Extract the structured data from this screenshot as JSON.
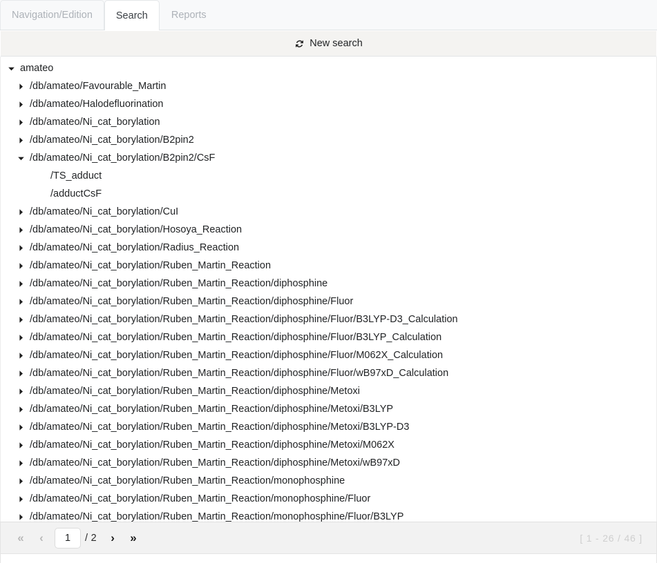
{
  "tabs": [
    {
      "label": "Navigation/Edition",
      "active": false
    },
    {
      "label": "Search",
      "active": true
    },
    {
      "label": "Reports",
      "active": false
    }
  ],
  "toolbar": {
    "new_search_label": "New search",
    "refresh_icon": "refresh-icon"
  },
  "tree": {
    "nodes": [
      {
        "label": "amateo",
        "level": 0,
        "state": "expanded"
      },
      {
        "label": "/db/amateo/Favourable_Martin",
        "level": 1,
        "state": "collapsed"
      },
      {
        "label": "/db/amateo/Halodefluorination",
        "level": 1,
        "state": "collapsed"
      },
      {
        "label": "/db/amateo/Ni_cat_borylation",
        "level": 1,
        "state": "collapsed"
      },
      {
        "label": "/db/amateo/Ni_cat_borylation/B2pin2",
        "level": 1,
        "state": "collapsed"
      },
      {
        "label": "/db/amateo/Ni_cat_borylation/B2pin2/CsF",
        "level": 1,
        "state": "expanded"
      },
      {
        "label": "/TS_adduct",
        "level": 2,
        "state": "leaf"
      },
      {
        "label": "/adductCsF",
        "level": 2,
        "state": "leaf"
      },
      {
        "label": "/db/amateo/Ni_cat_borylation/CuI",
        "level": 1,
        "state": "collapsed"
      },
      {
        "label": "/db/amateo/Ni_cat_borylation/Hosoya_Reaction",
        "level": 1,
        "state": "collapsed"
      },
      {
        "label": "/db/amateo/Ni_cat_borylation/Radius_Reaction",
        "level": 1,
        "state": "collapsed"
      },
      {
        "label": "/db/amateo/Ni_cat_borylation/Ruben_Martin_Reaction",
        "level": 1,
        "state": "collapsed"
      },
      {
        "label": "/db/amateo/Ni_cat_borylation/Ruben_Martin_Reaction/diphosphine",
        "level": 1,
        "state": "collapsed"
      },
      {
        "label": "/db/amateo/Ni_cat_borylation/Ruben_Martin_Reaction/diphosphine/Fluor",
        "level": 1,
        "state": "collapsed"
      },
      {
        "label": "/db/amateo/Ni_cat_borylation/Ruben_Martin_Reaction/diphosphine/Fluor/B3LYP-D3_Calculation",
        "level": 1,
        "state": "collapsed"
      },
      {
        "label": "/db/amateo/Ni_cat_borylation/Ruben_Martin_Reaction/diphosphine/Fluor/B3LYP_Calculation",
        "level": 1,
        "state": "collapsed"
      },
      {
        "label": "/db/amateo/Ni_cat_borylation/Ruben_Martin_Reaction/diphosphine/Fluor/M062X_Calculation",
        "level": 1,
        "state": "collapsed"
      },
      {
        "label": "/db/amateo/Ni_cat_borylation/Ruben_Martin_Reaction/diphosphine/Fluor/wB97xD_Calculation",
        "level": 1,
        "state": "collapsed"
      },
      {
        "label": "/db/amateo/Ni_cat_borylation/Ruben_Martin_Reaction/diphosphine/Metoxi",
        "level": 1,
        "state": "collapsed"
      },
      {
        "label": "/db/amateo/Ni_cat_borylation/Ruben_Martin_Reaction/diphosphine/Metoxi/B3LYP",
        "level": 1,
        "state": "collapsed"
      },
      {
        "label": "/db/amateo/Ni_cat_borylation/Ruben_Martin_Reaction/diphosphine/Metoxi/B3LYP-D3",
        "level": 1,
        "state": "collapsed"
      },
      {
        "label": "/db/amateo/Ni_cat_borylation/Ruben_Martin_Reaction/diphosphine/Metoxi/M062X",
        "level": 1,
        "state": "collapsed"
      },
      {
        "label": "/db/amateo/Ni_cat_borylation/Ruben_Martin_Reaction/diphosphine/Metoxi/wB97xD",
        "level": 1,
        "state": "collapsed"
      },
      {
        "label": "/db/amateo/Ni_cat_borylation/Ruben_Martin_Reaction/monophosphine",
        "level": 1,
        "state": "collapsed"
      },
      {
        "label": "/db/amateo/Ni_cat_borylation/Ruben_Martin_Reaction/monophosphine/Fluor",
        "level": 1,
        "state": "collapsed"
      },
      {
        "label": "/db/amateo/Ni_cat_borylation/Ruben_Martin_Reaction/monophosphine/Fluor/B3LYP",
        "level": 1,
        "state": "collapsed"
      }
    ]
  },
  "pagination": {
    "first_label": "«",
    "prev_label": "‹",
    "next_label": "›",
    "last_label": "»",
    "current_page": "1",
    "total_pages": "/ 2",
    "range_info": "[ 1 - 26 / 46 ]",
    "first_enabled": false,
    "prev_enabled": false,
    "next_enabled": true,
    "last_enabled": true
  },
  "colors": {
    "tab_active_text": "#3b4045",
    "tab_inactive_text": "#adb2b8",
    "toolbar_bg": "#f4f3f1",
    "footer_bg": "#f2f2f2",
    "range_text": "#cfcfcf"
  }
}
